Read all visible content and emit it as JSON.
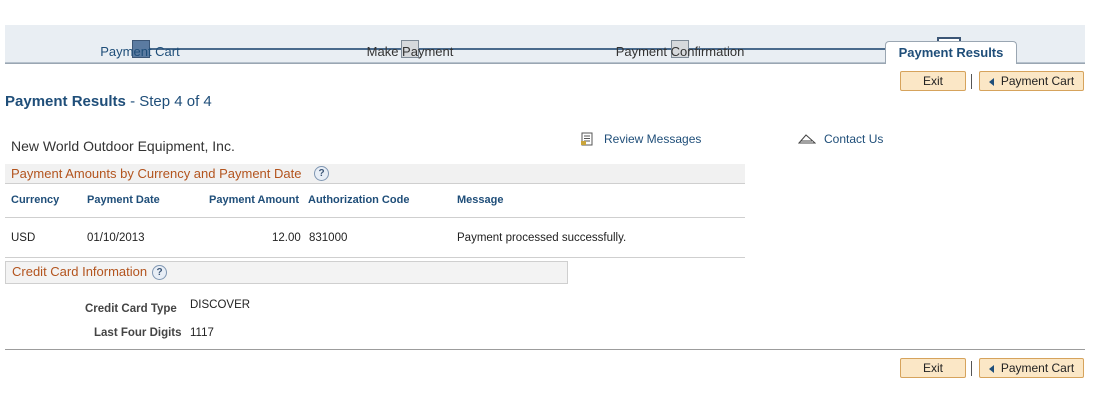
{
  "steps": [
    {
      "label": "Payment Cart",
      "state": "done"
    },
    {
      "label": "Make Payment",
      "state": "pending"
    },
    {
      "label": "Payment Confirmation",
      "state": "pending"
    },
    {
      "label": "Payment Results",
      "state": "current"
    }
  ],
  "toolbar": {
    "exit_label": "Exit",
    "separator": "|",
    "cart_label": "Payment Cart"
  },
  "page": {
    "title": "Payment Results",
    "subtitle": "- Step 4 of 4"
  },
  "company": "New World Outdoor Equipment, Inc.",
  "links": {
    "review_messages": "Review Messages",
    "contact_us": "Contact Us"
  },
  "payment_grid": {
    "title": "Payment Amounts by Currency and Payment Date",
    "columns": [
      "Currency",
      "Payment Date",
      "Payment Amount",
      "Authorization Code",
      "Message"
    ],
    "rows": [
      [
        "USD",
        "01/10/2013",
        "12.00",
        "831000",
        "Payment processed successfully."
      ]
    ]
  },
  "credit_card": {
    "title": "Credit Card Information",
    "type_label": "Credit Card Type",
    "type_value": "DISCOVER",
    "digits_label": "Last Four Digits",
    "digits_value": "1117"
  },
  "help_glyph": "?",
  "colors": {
    "accent": "#1f4e79",
    "section_title": "#b3541e",
    "button_bg": "#fbe7c6",
    "current_step": "#f7a823"
  }
}
